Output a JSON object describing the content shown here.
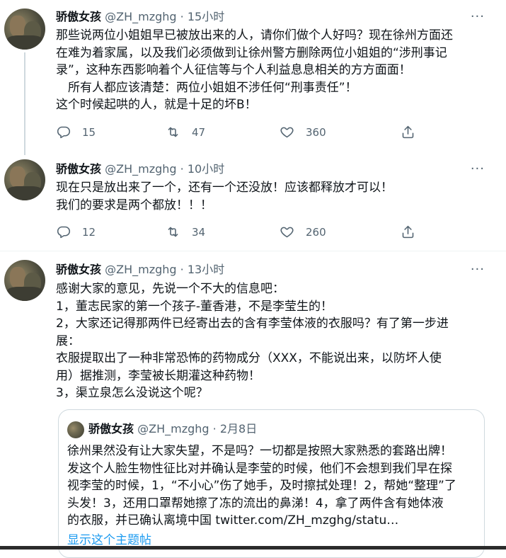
{
  "tweets": [
    {
      "name": "骄傲女孩",
      "handle": "@ZH_mzghg",
      "dot": "·",
      "time": "15小时",
      "more": "···",
      "lines": [
        "那些说两位小姐姐早已被放出来的人，请你们做个人好吗？现在徐州方面还",
        "在难为着家属，以及我们必须做到让徐州警方删除两位小姐姐的“涉刑事记",
        "录”，这种东西影响着个人征信等与个人利益息息相关的方方面面！",
        "　所有人都应该清楚：两位小姐姐不涉任何“刑事责任”！",
        "这个时候起哄的人，就是十足的坏B！"
      ],
      "replies": "15",
      "retweets": "47",
      "likes": "360"
    },
    {
      "name": "骄傲女孩",
      "handle": "@ZH_mzghg",
      "dot": "·",
      "time": "10小时",
      "more": "···",
      "lines": [
        "现在只是放出来了一个，还有一个还没放！应该都释放才可以！",
        "我们的要求是两个都放！！！"
      ],
      "replies": "12",
      "retweets": "34",
      "likes": "260"
    },
    {
      "name": "骄傲女孩",
      "handle": "@ZH_mzghg",
      "dot": "·",
      "time": "13小时",
      "more": "···",
      "lines": [
        "感谢大家的意见，先说一个不大的信息吧：",
        "1，董志民家的第一个孩子-董香港，不是李莹生的！",
        "2，大家还记得那两件已经寄出去的含有李莹体液的衣服吗？有了第一步进",
        "展：",
        "衣服提取出了一种非常恐怖的药物成分（XXX，不能说出来，以防坏人使",
        "用）据推测，李莹被长期灌这种药物！",
        "3，渠立泉怎么没说这个呢？"
      ]
    }
  ],
  "quote": {
    "name": "骄傲女孩",
    "handle": "@ZH_mzghg",
    "dot": "·",
    "date": "2月8日",
    "lines": [
      "徐州果然没有让大家失望，不是吗？一切都是按照大家熟悉的套路出牌！",
      "发这个人脸生物性征比对并确认是李莹的时候，他们不会想到我们早在探",
      "视李莹的时候，1，“不小心”伤了她手，及时擦拭处理！2，帮她“整理”了",
      "头发！3，还用口罩帮她擦了冻的流出的鼻涕！4，拿了两件含有她体液",
      "的衣服，并已确认离境中国  twitter.com/ZH_mzghg/statu…"
    ],
    "show_thread": "显示这个主题帖"
  },
  "icons": {
    "reply": "reply-icon",
    "retweet": "retweet-icon",
    "like": "like-icon",
    "share": "share-icon",
    "more": "more-icon"
  },
  "colors": {
    "text": "#0f1419",
    "secondary": "#536471",
    "link": "#1d9bf0",
    "border": "#cfd9de"
  }
}
